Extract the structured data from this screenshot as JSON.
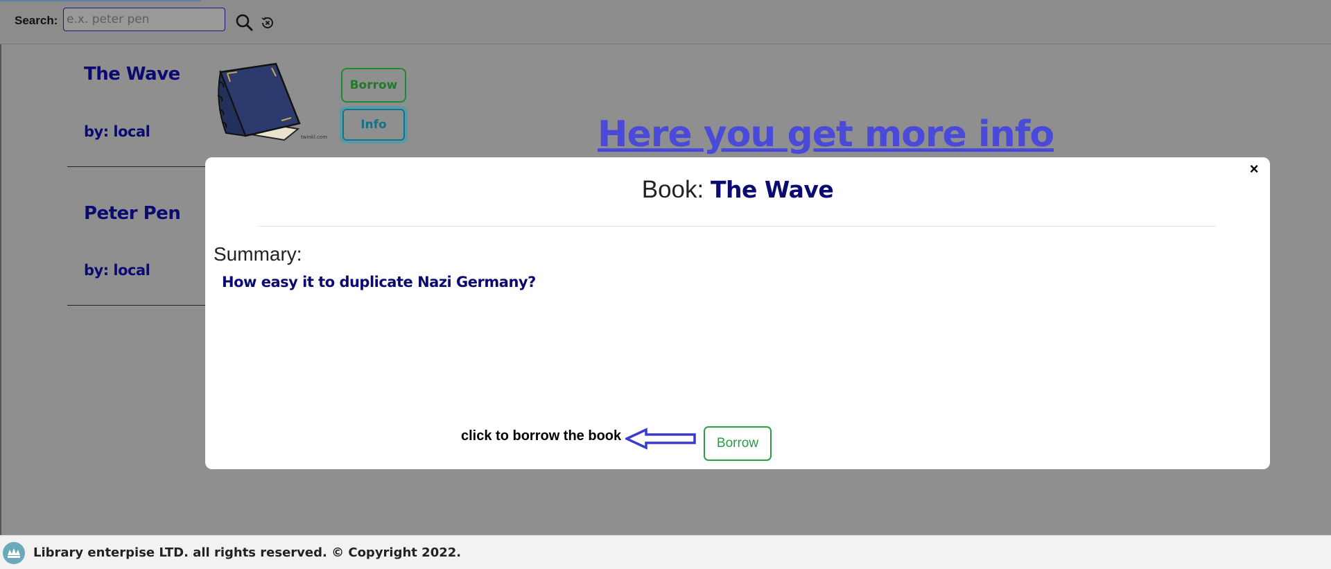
{
  "search": {
    "label": "Search:",
    "placeholder": "e.x. peter pen",
    "value": ""
  },
  "books": [
    {
      "title": "The Wave",
      "author": "by: local",
      "image_caption": "twinkl.com"
    },
    {
      "title": "Peter Pen",
      "author": "by: local"
    }
  ],
  "book_actions": {
    "borrow_label": "Borrow",
    "info_label": "Info"
  },
  "annotations": {
    "more_info": "Here you get more info",
    "click_to_borrow": "click to borrow the book"
  },
  "modal": {
    "title_prefix": "Book:",
    "title_name": "The Wave",
    "close_symbol": "×",
    "summary_heading": "Summary:",
    "summary_text": "How easy it to duplicate Nazi Germany?",
    "borrow_label": "Borrow"
  },
  "footer": {
    "text": "Library enterpise LTD. all rights reserved. © Copyright 2022."
  },
  "colors": {
    "overlay": "#8f8f8f",
    "title_navy": "#0a0a70",
    "annotation_blue": "#4a4ad8",
    "borrow_green": "#1f8a2e",
    "info_teal": "#137387"
  },
  "icons": {
    "search": "search-icon",
    "clear": "clear-search-icon",
    "close": "close-icon",
    "logo": "library-logo-icon",
    "arrow": "arrow-left-icon"
  }
}
